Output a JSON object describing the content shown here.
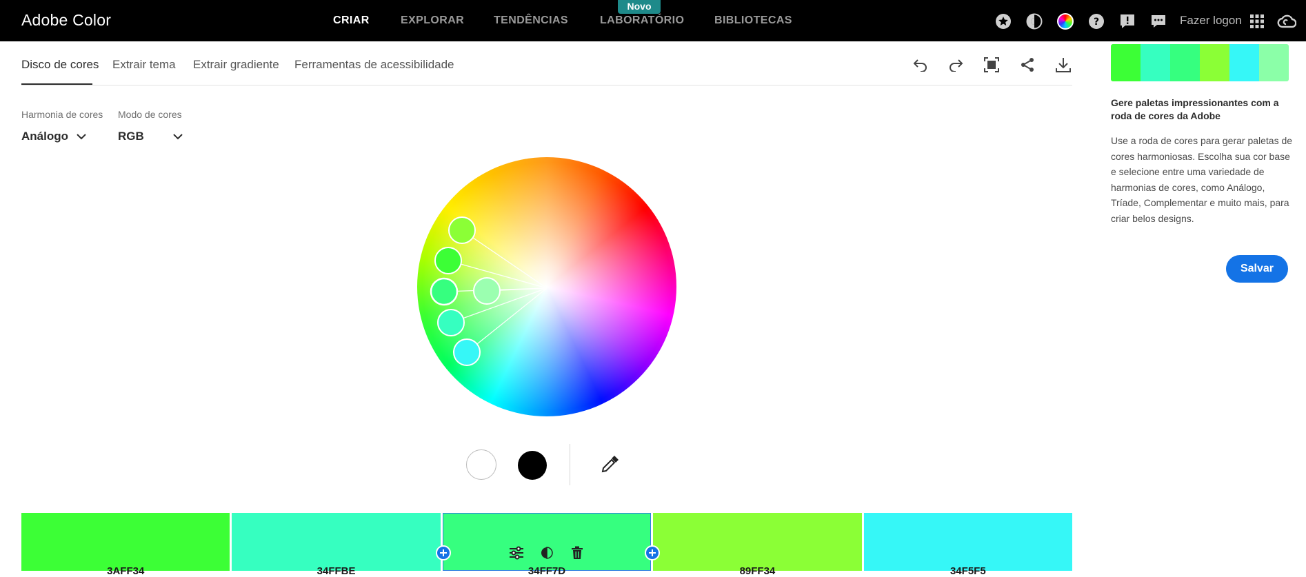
{
  "app": {
    "title": "Adobe Color"
  },
  "nav": {
    "items": [
      {
        "label": "CRIAR",
        "active": true
      },
      {
        "label": "EXPLORAR",
        "active": false
      },
      {
        "label": "TENDÊNCIAS",
        "active": false
      },
      {
        "label": "LABORATÓRIO",
        "active": false
      },
      {
        "label": "BIBLIOTECAS",
        "active": false
      }
    ],
    "badge": "Novo",
    "login": "Fazer logon",
    "icons": [
      "star-badge-icon",
      "contrast-icon",
      "color-wheel-icon",
      "help-icon",
      "feedback-icon",
      "chat-icon",
      "app-grid-icon",
      "creative-cloud-icon"
    ]
  },
  "tabs": [
    {
      "label": "Disco de cores",
      "active": true
    },
    {
      "label": "Extrair tema",
      "active": false
    },
    {
      "label": "Extrair gradiente",
      "active": false
    },
    {
      "label": "Ferramentas de acessibilidade",
      "active": false
    }
  ],
  "toolbar_icons": [
    "undo-icon",
    "redo-icon",
    "fit-screen-icon",
    "share-icon",
    "download-icon"
  ],
  "controls": {
    "harmony": {
      "label": "Harmonia de cores",
      "value": "Análogo"
    },
    "mode": {
      "label": "Modo de cores",
      "value": "RGB"
    }
  },
  "palette": [
    {
      "hex": "#3CFF36",
      "code": "3AFF34"
    },
    {
      "hex": "#36FFC0",
      "code": "34FFBE"
    },
    {
      "hex": "#36FF7F",
      "code": "34FF7D"
    },
    {
      "hex": "#8BFF36",
      "code": "89FF34"
    },
    {
      "hex": "#36F7F7",
      "code": "34F5F5"
    }
  ],
  "mini_palette": [
    "#3CFF36",
    "#36FFC0",
    "#36FF7F",
    "#8BFF36",
    "#36F7F7",
    "#8BFFA8"
  ],
  "right_panel": {
    "title": "Gere paletas impressionantes com a roda de cores da Adobe",
    "body": "Use a roda de cores para gerar paletas de cores harmoniosas. Escolha sua cor base e selecione entre uma variedade de harmonias de cores, como Análogo, Tríade, Complementar e muito mais, para criar belos designs.",
    "save": "Salvar"
  }
}
